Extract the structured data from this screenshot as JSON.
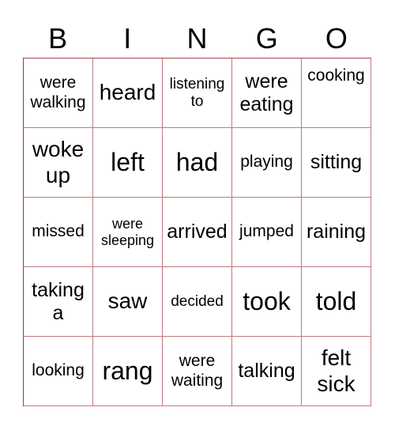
{
  "header": [
    "B",
    "I",
    "N",
    "G",
    "O"
  ],
  "cells": [
    "were walking",
    "heard",
    "listening to",
    "were eating",
    "cooking",
    "woke up",
    "left",
    "had",
    "playing",
    "sitting",
    "missed",
    "were sleeping",
    "arrived",
    "jumped",
    "raining",
    "taking a",
    "saw",
    "decided",
    "took",
    "told",
    "looking",
    "rang",
    "were waiting",
    "talking",
    "felt sick"
  ],
  "colors": {
    "grid_border": "#b0474e",
    "text": "#000000",
    "background": "#ffffff"
  }
}
